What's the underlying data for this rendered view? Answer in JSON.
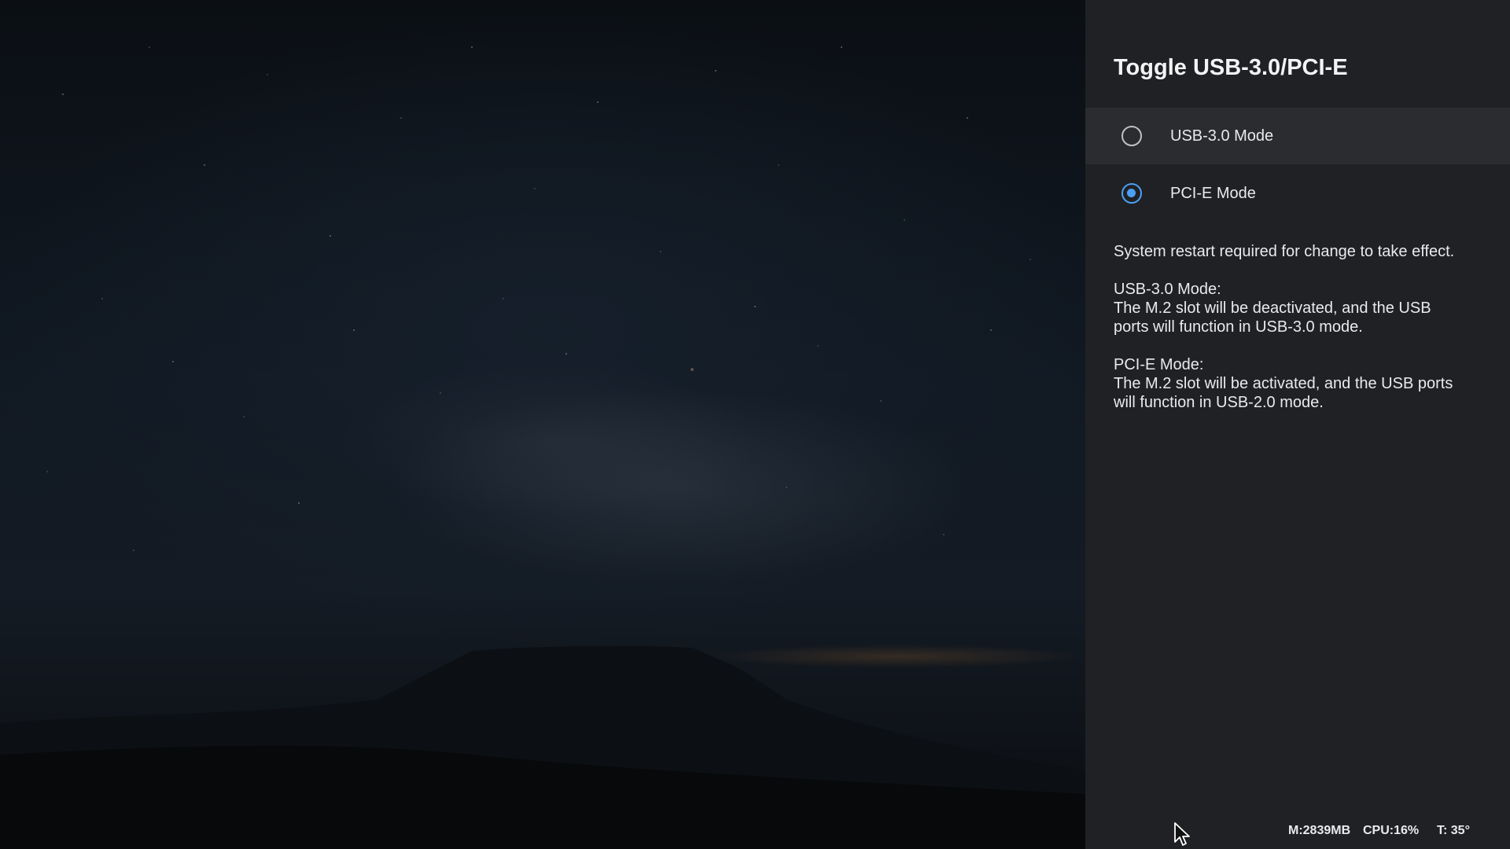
{
  "panel": {
    "title": "Toggle USB-3.0/PCI-E",
    "options": [
      {
        "label": "USB-3.0 Mode",
        "selected": false,
        "focused": true
      },
      {
        "label": "PCI-E Mode",
        "selected": true,
        "focused": false
      }
    ],
    "description": {
      "restart_note": "System restart required for change to take effect.",
      "usb_heading": "USB-3.0 Mode:",
      "usb_text": "The M.2 slot will be deactivated, and the USB ports will function in USB-3.0 mode.",
      "pcie_heading": "PCI-E Mode:",
      "pcie_text": "The M.2 slot will be activated, and the USB ports will function in USB-2.0 mode."
    }
  },
  "status_bar": {
    "memory": "M:2839MB",
    "cpu": "CPU:16%",
    "temperature": "T: 35°"
  },
  "icons": {
    "radio_unchecked": "radio-unchecked-icon",
    "radio_checked": "radio-checked-icon",
    "cursor": "mouse-pointer-icon"
  },
  "colors": {
    "panel_background": "#202124",
    "focused_row": "#2b2c2f",
    "accent": "#4d9ff5",
    "text": "#e8eaed"
  }
}
